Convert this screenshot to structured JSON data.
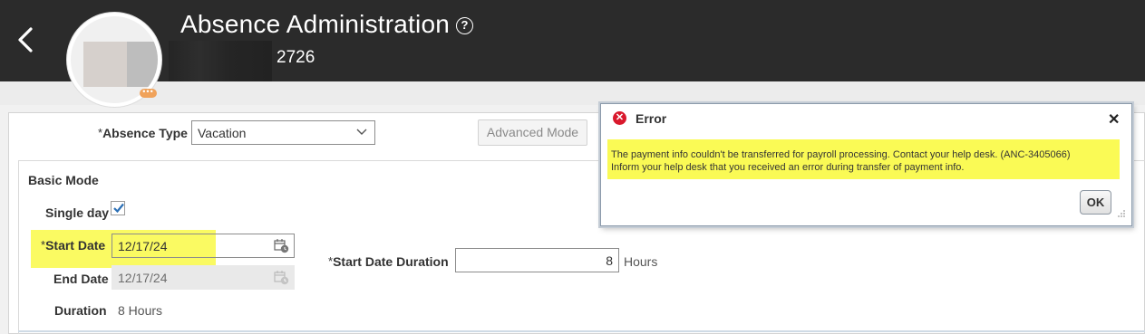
{
  "header": {
    "title": "Absence Administration",
    "person_id": "2726",
    "avatar_badge": "•••"
  },
  "form": {
    "absence_type_label": "Absence Type",
    "absence_type_value": "Vacation",
    "advanced_mode_label": "Advanced Mode",
    "basic_mode_label": "Basic Mode",
    "single_day_label": "Single day",
    "single_day_checked": true,
    "start_date_label": "Start Date",
    "start_date_value": "12/17/24",
    "end_date_label": "End Date",
    "end_date_value": "12/17/24",
    "duration_label": "Duration",
    "duration_value": "8 Hours",
    "start_date_duration_label": "Start Date Duration",
    "start_date_duration_value": "8",
    "start_date_duration_unit": "Hours",
    "required_marker": "*"
  },
  "dialog": {
    "title": "Error",
    "close_glyph": "✕",
    "message_line1": "The payment info couldn't be transferred for payroll processing. Contact your help desk. (ANC-3405066)",
    "message_line2": "Inform your help desk that you received an error during transfer of payment info.",
    "ok_label": "OK"
  },
  "colors": {
    "header_bg": "#2b2b2b",
    "highlight": "#fafa55",
    "error_red": "#d9182c",
    "checkbox_blue": "#2b6fb5"
  }
}
